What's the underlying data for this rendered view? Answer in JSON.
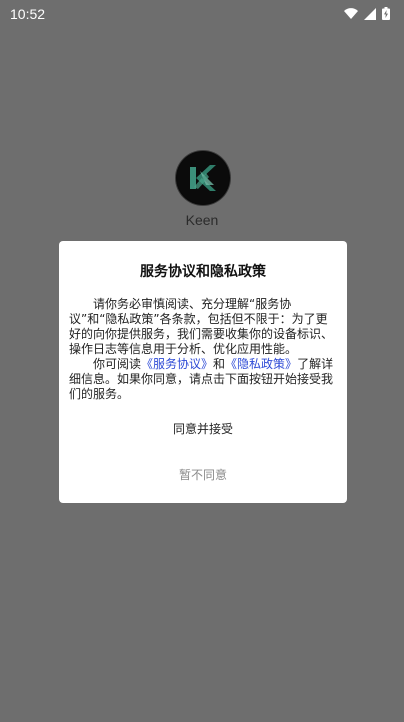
{
  "status_bar": {
    "time": "10:52",
    "icons": [
      "wifi-icon",
      "signal-icon",
      "battery-charging-icon"
    ]
  },
  "app": {
    "name": "Keen",
    "logo_icon": "keen-logo"
  },
  "dialog": {
    "title": "服务协议和隐私政策",
    "paragraph1": "请你务必审慎阅读、充分理解“服务协议”和“隐私政策”各条款，包括但不限于：为了更好的向你提供服务，我们需要收集你的设备标识、操作日志等信息用于分析、优化应用性能。",
    "paragraph2_prefix": "你可阅读",
    "service_agreement_link": "《服务协议》",
    "conjunction": "和",
    "privacy_policy_link": "《隐私政策》",
    "paragraph2_suffix": "了解详细信息。如果你同意，请点击下面按钮开始接受我们的服务。",
    "accept_label": "同意并接受",
    "decline_label": "暂不同意"
  },
  "colors": {
    "overlay": "#6e6e6e",
    "link": "#2d4ad6",
    "decline_text": "#8a8a8a"
  }
}
